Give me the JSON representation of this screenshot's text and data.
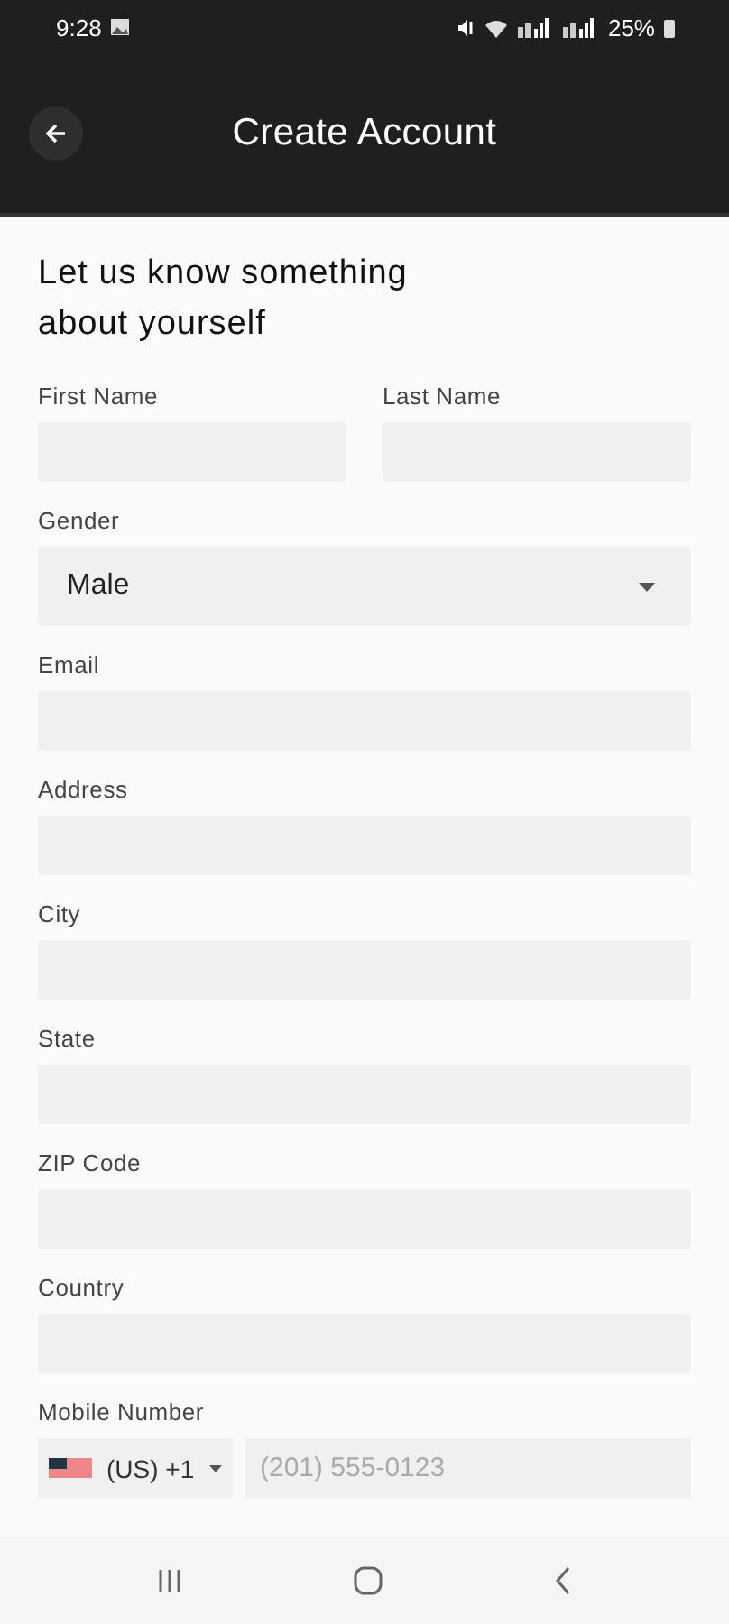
{
  "status_bar": {
    "time": "9:28",
    "battery": "25%"
  },
  "header": {
    "title": "Create Account"
  },
  "heading": "Let us know something about yourself",
  "rows": [
    {
      "fields": [
        {
          "kind": "text",
          "label": "First Name"
        },
        {
          "kind": "text",
          "label": "Last Name"
        }
      ]
    },
    {
      "fields": [
        {
          "kind": "select",
          "label": "Gender",
          "value": "Male"
        }
      ]
    },
    {
      "fields": [
        {
          "kind": "text",
          "label": "Email"
        }
      ]
    },
    {
      "fields": [
        {
          "kind": "text",
          "label": "Address"
        }
      ]
    },
    {
      "fields": [
        {
          "kind": "text",
          "label": "City"
        }
      ]
    },
    {
      "fields": [
        {
          "kind": "text",
          "label": "State"
        }
      ]
    },
    {
      "fields": [
        {
          "kind": "text",
          "label": "ZIP Code"
        }
      ]
    },
    {
      "fields": [
        {
          "kind": "text",
          "label": "Country"
        }
      ]
    },
    {
      "fields": [
        {
          "kind": "phone",
          "label": "Mobile Number",
          "country_code": "(US) +1",
          "placeholder": "(201) 555-0123"
        }
      ]
    }
  ]
}
